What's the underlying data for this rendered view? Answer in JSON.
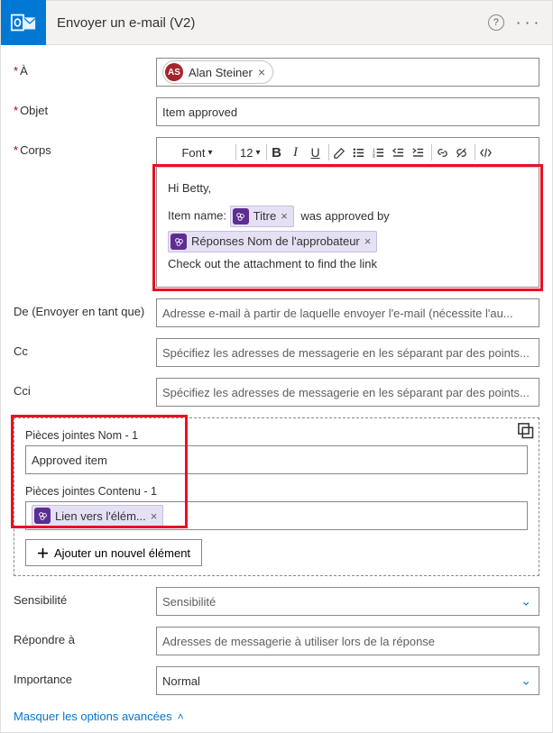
{
  "header": {
    "title": "Envoyer un e-mail (V2)"
  },
  "labels": {
    "to": "À",
    "subject": "Objet",
    "body": "Corps",
    "from": "De (Envoyer en tant que)",
    "cc": "Cc",
    "bcc": "Cci",
    "sensitivity": "Sensibilité",
    "replyto": "Répondre à",
    "importance": "Importance"
  },
  "to": {
    "recipient_name": "Alan Steiner",
    "recipient_initials": "AS"
  },
  "subject": {
    "value": "Item approved"
  },
  "toolbar": {
    "font_label": "Font",
    "size_label": "12"
  },
  "bodytext": {
    "greeting": "Hi Betty,",
    "line_prefix": "Item name:",
    "token_title": "Titre",
    "line_mid": "was approved by",
    "token_approver": "Réponses Nom de l'approbateur",
    "line3": "Check out the attachment to find the link"
  },
  "from": {
    "placeholder": "Adresse e-mail à partir de laquelle envoyer l'e-mail (nécessite l'au..."
  },
  "cc": {
    "placeholder": "Spécifiez les adresses de messagerie en les séparant par des points..."
  },
  "bcc": {
    "placeholder": "Spécifiez les adresses de messagerie en les séparant par des points..."
  },
  "attachments": {
    "name_label": "Pièces jointes Nom - 1",
    "name_value": "Approved item",
    "content_label": "Pièces jointes Contenu - 1",
    "content_token": "Lien vers l'élém...",
    "add_label": "Ajouter un nouvel élément"
  },
  "sensitivity": {
    "placeholder": "Sensibilité"
  },
  "replyto": {
    "placeholder": "Adresses de messagerie à utiliser lors de la réponse"
  },
  "importance": {
    "value": "Normal"
  },
  "footer": {
    "hide_advanced": "Masquer les options avancées"
  }
}
